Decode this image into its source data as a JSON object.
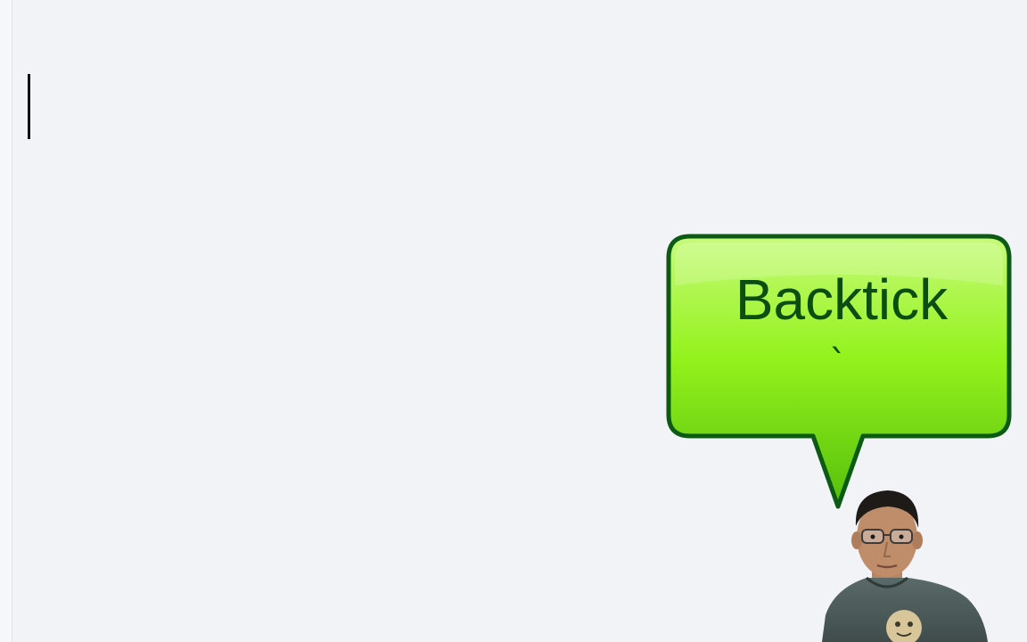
{
  "editor": {
    "content": "",
    "cursor_visible": true
  },
  "key_overlay": {
    "title": "Backtick",
    "key_glyph": "`",
    "colors": {
      "fill_top": "#bdf86a",
      "fill_mid": "#8ef018",
      "fill_bottom": "#58c20a",
      "border": "#0c5a14",
      "text": "#0c4d12"
    }
  },
  "presenter_video": {
    "icon": "person-webcam-icon"
  },
  "colors": {
    "background": "#f2f3f7",
    "cursor": "#111111"
  }
}
